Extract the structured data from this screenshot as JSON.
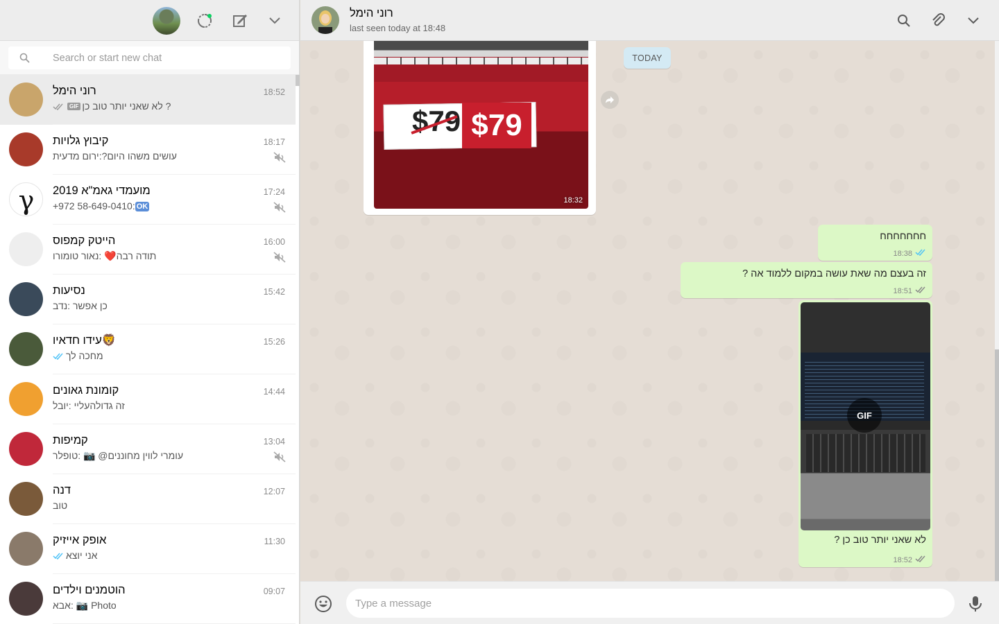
{
  "sidebar": {
    "search_placeholder": "Search or start new chat",
    "chats": [
      {
        "name": "רוני הימל",
        "time": "18:52",
        "preview": "לא שאני יותר טוב כן ?",
        "ticks": "read",
        "gif": "GIF",
        "muted": false,
        "active": true,
        "avatar_color": "#c9a56b"
      },
      {
        "name": "קיבוץ גלויות",
        "time": "18:17",
        "preview": "עושים משהו היום?:ירום מדעית",
        "muted": true,
        "avatar_color": "#a83a2a"
      },
      {
        "name": "מועמדי גאמ\"א 2019",
        "time": "17:24",
        "preview": "+972 58-649-0410:",
        "ok": "OK",
        "muted": true,
        "avatar_color": "#ffffff"
      },
      {
        "name": "הייטק קמפוס",
        "time": "16:00",
        "preview": "תודה רבה❤️ :נאור טומורו",
        "muted": true,
        "avatar_color": "#eeeeee"
      },
      {
        "name": "נסיעות",
        "time": "15:42",
        "preview": "כן אפשר :נדב",
        "muted": false,
        "avatar_color": "#3a4a5a"
      },
      {
        "name": "🦁עידו חדאיו",
        "time": "15:26",
        "preview": "מחכה לך",
        "ticks": "read",
        "muted": false,
        "avatar_color": "#4a5a3a"
      },
      {
        "name": "קומונת גאונים",
        "time": "14:44",
        "preview": "זה גדולהעליי :יובל",
        "muted": false,
        "avatar_color": "#f0a030"
      },
      {
        "name": "קמיפות",
        "time": "13:04",
        "preview": "עומרי לווין מחוננים@ 📷 :טופלר",
        "muted": true,
        "avatar_color": "#c0283a"
      },
      {
        "name": "דנה",
        "time": "12:07",
        "preview": "טוב",
        "muted": false,
        "avatar_color": "#7a5a3a"
      },
      {
        "name": "אופק אייזיק",
        "time": "11:30",
        "preview": "אני יוצא",
        "ticks": "read",
        "muted": false,
        "avatar_color": "#8a7a6a"
      },
      {
        "name": "הוטמנים וילדים",
        "time": "09:07",
        "preview": "אבא: 📷 Photo",
        "muted": false,
        "avatar_color": "#4a3a3a"
      }
    ]
  },
  "conversation": {
    "contact_name": "רוני הימל",
    "contact_status": "last seen today at 18:48",
    "date_chip": "TODAY",
    "messages": {
      "image_in": {
        "time": "18:32",
        "old_price": "$79",
        "new_price": "$79"
      },
      "msg1": {
        "text": "חחחחחחח",
        "time": "18:38"
      },
      "msg2": {
        "text": "זה בעצם מה שאת עושה במקום ללמוד אה ?",
        "time": "18:51"
      },
      "gif": {
        "label": "GIF",
        "caption": "לא שאני יותר טוב כן ?",
        "time": "18:52"
      }
    },
    "compose_placeholder": "Type a message"
  },
  "colors": {
    "outgoing_bubble": "#dcf8c6",
    "incoming_bubble": "#ffffff",
    "read_ticks": "#4fc3f7",
    "header_bg": "#ededed"
  },
  "icons": [
    "profile-avatar",
    "status-icon",
    "new-chat-icon",
    "menu-chevron-icon",
    "search-icon",
    "attach-icon",
    "mute-icon",
    "forward-icon",
    "emoji-icon",
    "mic-icon"
  ]
}
